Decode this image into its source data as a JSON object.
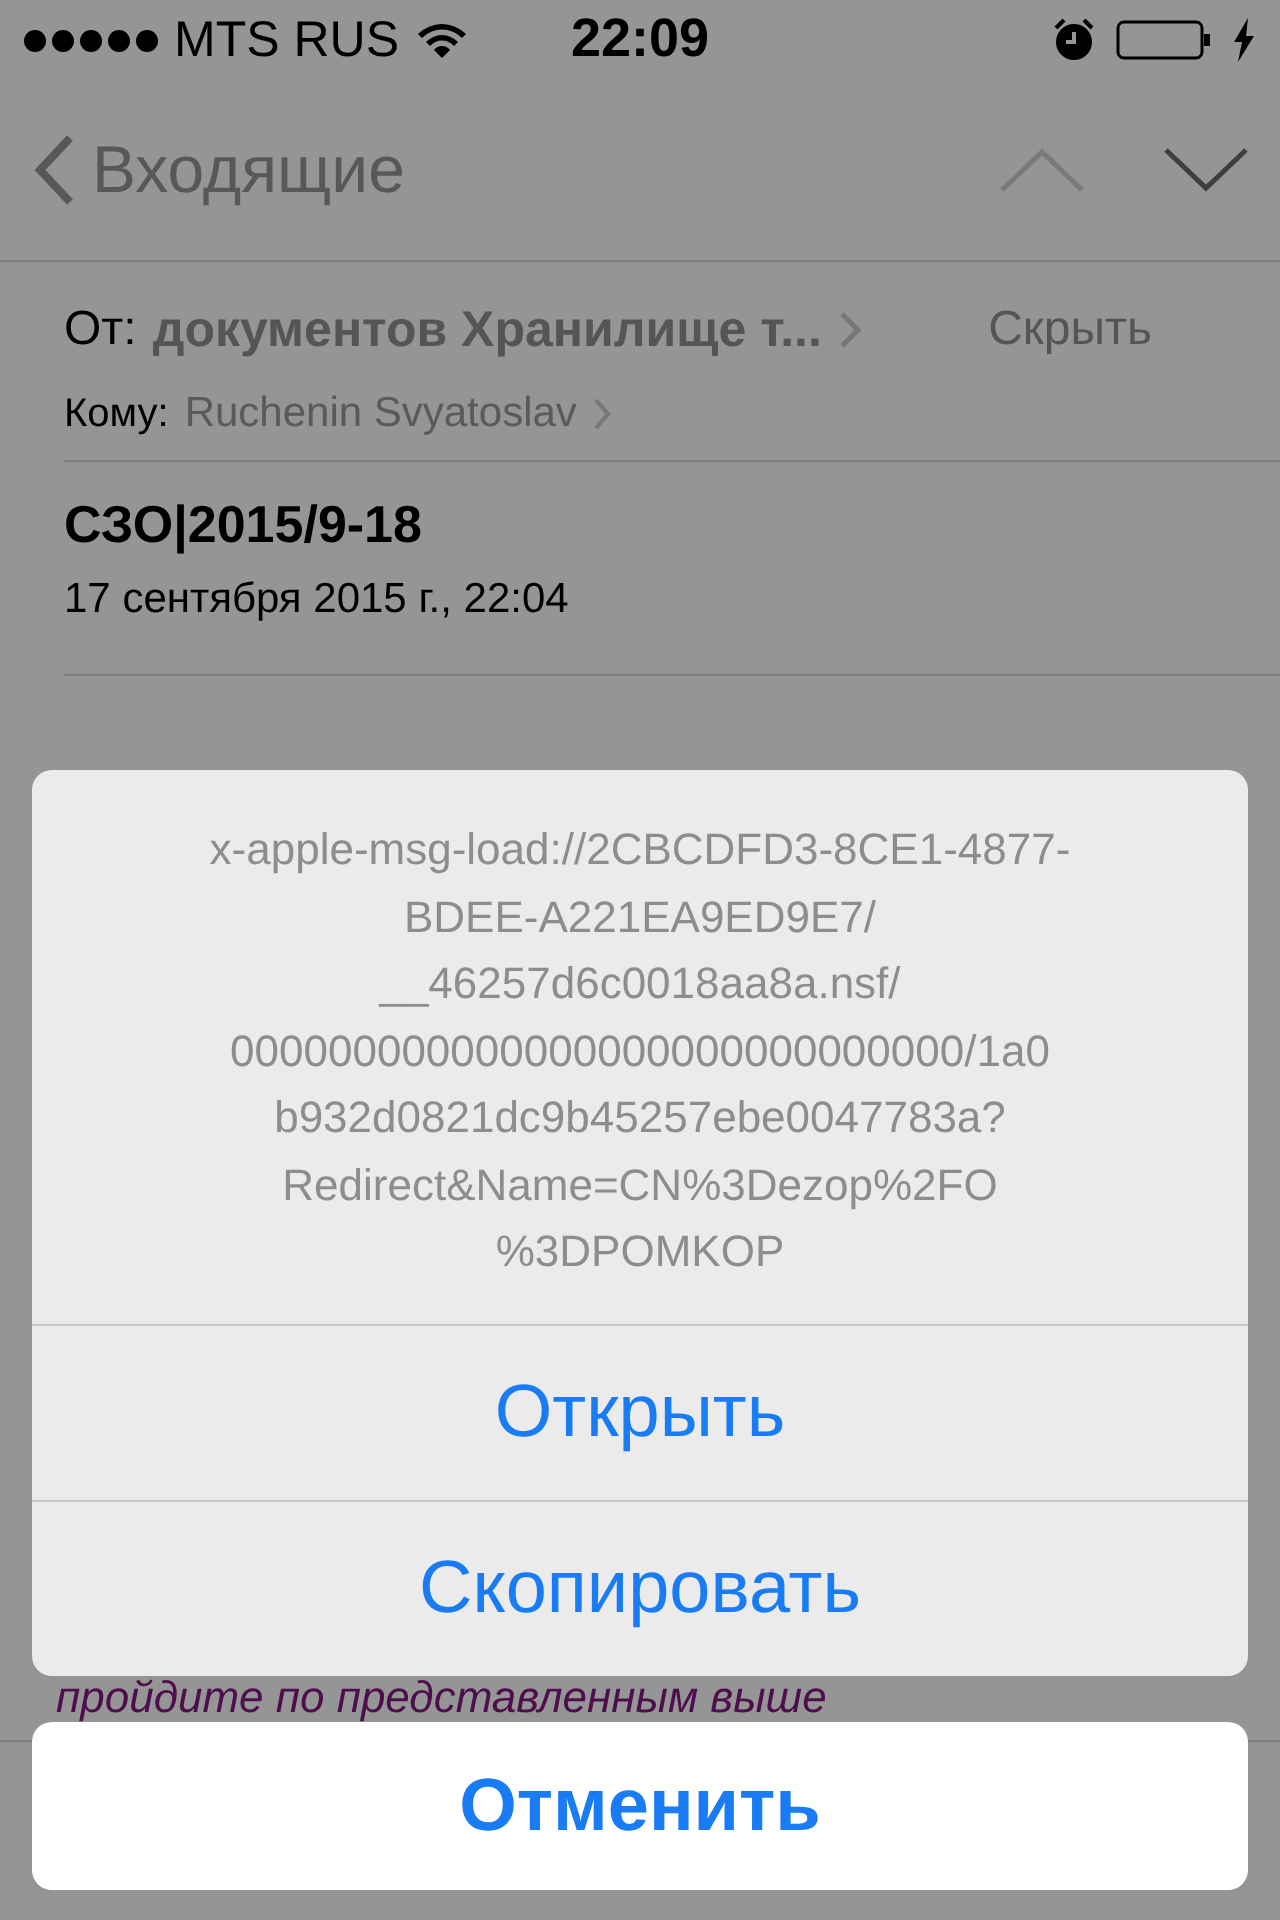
{
  "status_bar": {
    "carrier": "MTS RUS",
    "time": "22:09"
  },
  "nav": {
    "back": "Входящие"
  },
  "header": {
    "from_label": "От:",
    "from": "документов Хранилище т...",
    "hide": "Скрыть",
    "to_label": "Кому:",
    "to": "Ruchenin Svyatoslav"
  },
  "subject": "СЗО|2015/9-18",
  "date": "17 сентября 2015 г., 22:04",
  "body_line": "пройдите по представленным выше",
  "action_sheet": {
    "message_lines": [
      "x-apple-msg-load://2CBCDFD3-8CE1-4877-",
      "BDEE-A221EA9ED9E7/",
      "__46257d6c0018aa8a.nsf/",
      "000000000000000000000000000000/1a0",
      "b932d0821dc9b45257ebe0047783a?",
      "Redirect&Name=CN%3Dezop%2FO",
      "%3DPOMKOP"
    ],
    "actions": [
      "Открыть",
      "Скопировать"
    ],
    "cancel": "Отменить"
  }
}
